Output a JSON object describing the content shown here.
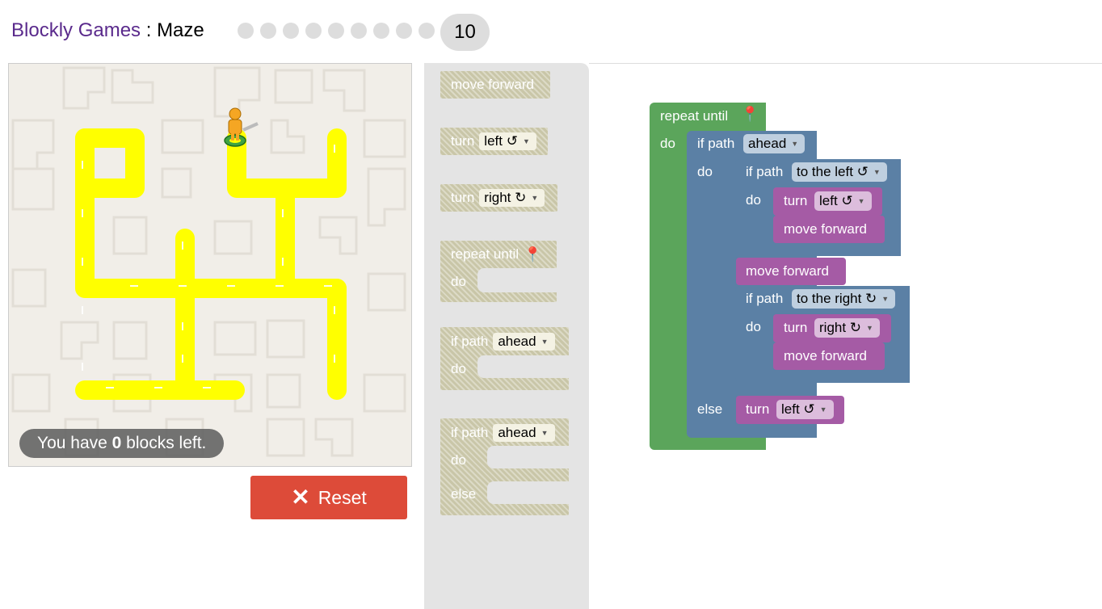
{
  "header": {
    "app_name": "Blockly Games",
    "separator": " : ",
    "game_name": "Maze",
    "completed_levels": 9,
    "current_level": "10"
  },
  "maze": {
    "capacity_prefix": "You have ",
    "capacity_count": "0",
    "capacity_suffix": " blocks left.",
    "reset_label": "Reset",
    "colors": {
      "path": "#ffff00",
      "background": "#f1eee8",
      "reset": "#dd4b39"
    }
  },
  "toolbox": {
    "move_forward": "move forward",
    "turn": "turn",
    "left": "left ↺",
    "right": "right ↻",
    "repeat_until": "repeat until",
    "do": "do",
    "if_path": "if path",
    "ahead": "ahead",
    "else": "else"
  },
  "workspace": {
    "repeat_until": "repeat until",
    "do": "do",
    "else": "else",
    "if_path": "if path",
    "ahead": "ahead",
    "to_the_left": "to the left ↺",
    "to_the_right": "to the right ↻",
    "turn": "turn",
    "left": "left ↺",
    "right": "right ↻",
    "move_forward": "move forward",
    "colors": {
      "loop": "#5ba55b",
      "logic": "#5b80a5",
      "movement": "#a55ba5"
    }
  }
}
